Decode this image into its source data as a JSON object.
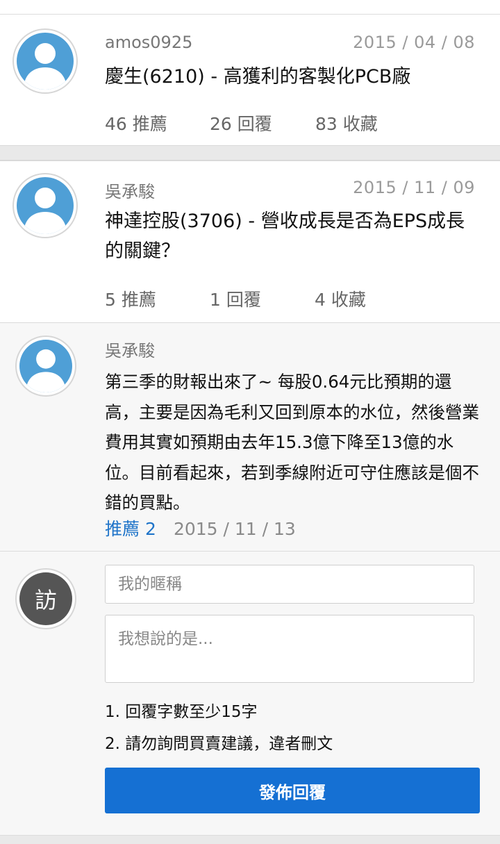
{
  "posts": [
    {
      "author": "amos0925",
      "date": "2015 / 04 / 08",
      "title": "慶生(6210) - 高獲利的客製化PCB廠",
      "stats": {
        "likes": "46 推薦",
        "replies": "26 回覆",
        "favorites": "83 收藏"
      }
    },
    {
      "author": "吳承駿",
      "date": "2015 / 11 / 09",
      "title": "神達控股(3706) - 營收成長是否為EPS成長的關鍵？",
      "stats": {
        "likes": "5 推薦",
        "replies": "1 回覆",
        "favorites": "4 收藏"
      }
    }
  ],
  "reply": {
    "author": "吳承駿",
    "body": "第三季的財報出來了~ 每股0.64元比預期的還高，主要是因為毛利又回到原本的水位，然後營業費用其實如預期由去年15.3億下降至13億的水位。目前看起來，若到季線附近可守住應該是個不錯的買點。",
    "like": "推薦 2",
    "date": "2015 / 11 / 13"
  },
  "form": {
    "visitor_label": "訪",
    "nickname_placeholder": "我的暱稱",
    "message_placeholder": "我想說的是...",
    "rules": [
      "1. 回覆字數至少15字",
      "2. 請勿詢問買賣建議，違者刪文"
    ],
    "submit_label": "發佈回覆"
  },
  "colors": {
    "accent": "#1570d3",
    "avatar": "#4f9fd6",
    "visitor": "#555555"
  }
}
